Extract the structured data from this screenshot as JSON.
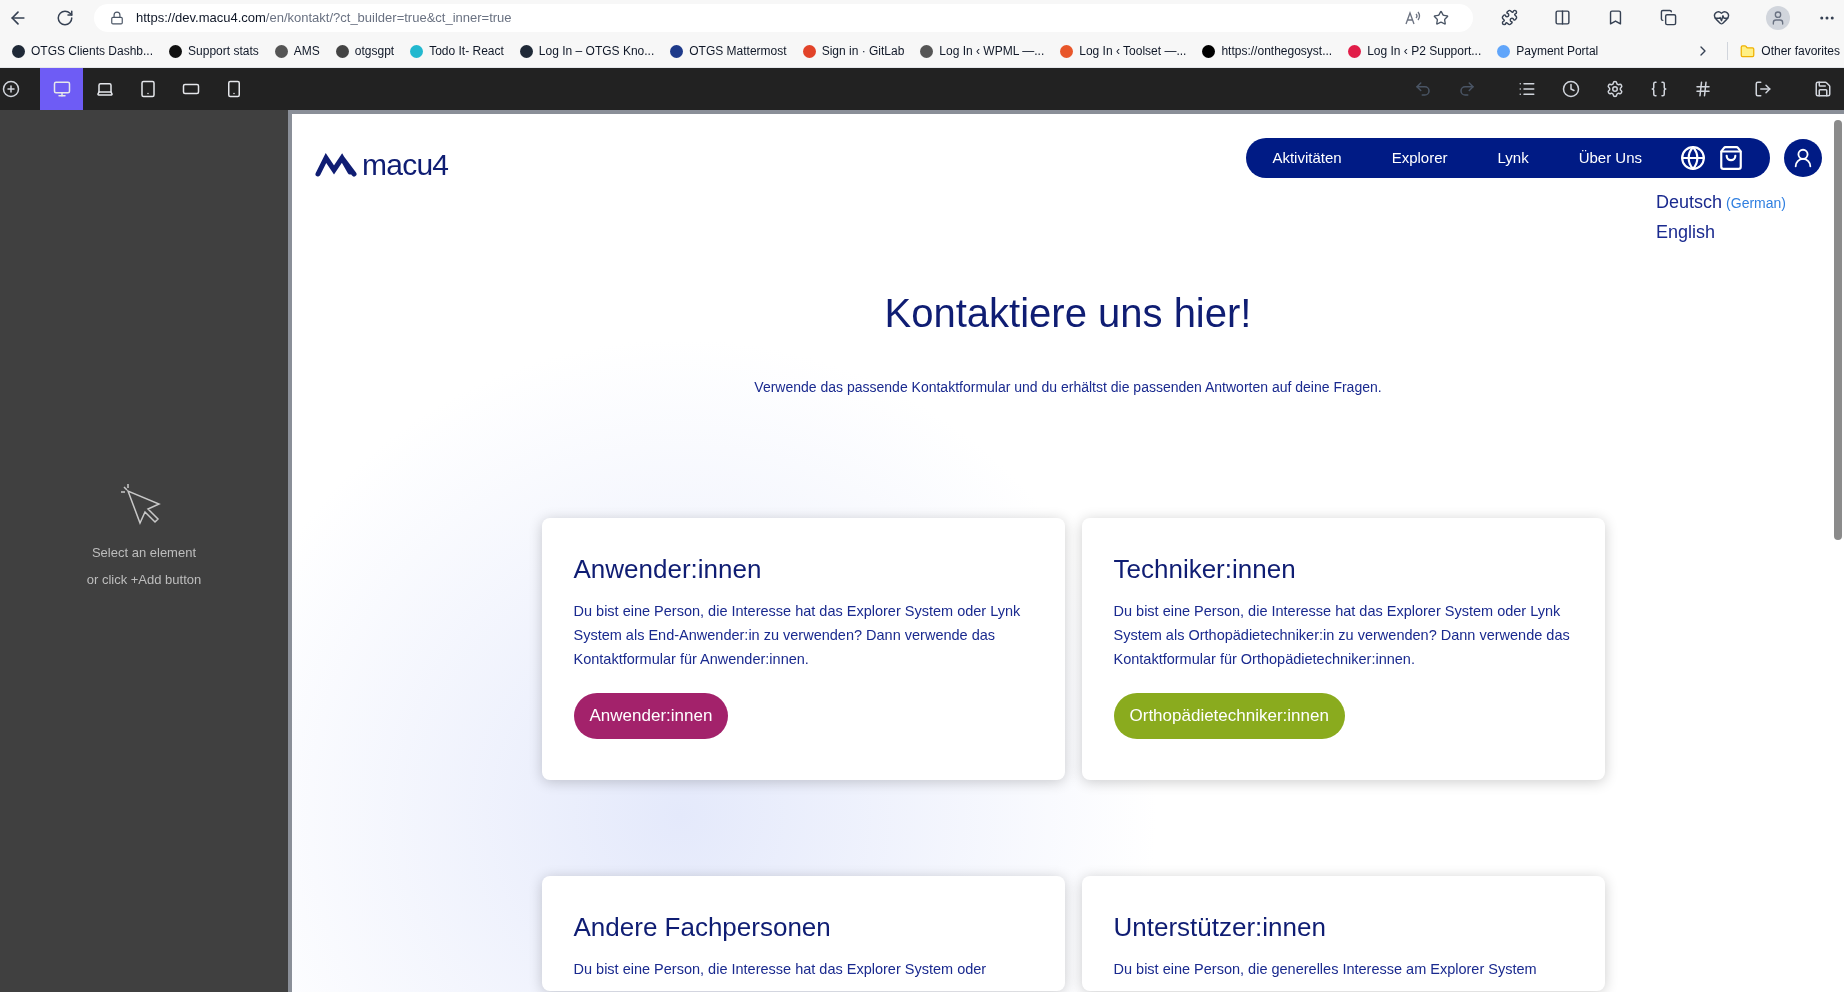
{
  "browser": {
    "url_host": "https://dev.macu4.com",
    "url_path": "/en/kontakt/?ct_builder=true&ct_inner=true",
    "bookmarks": [
      {
        "label": "OTGS Clients Dashb...",
        "color": "#1f2937"
      },
      {
        "label": "Support stats",
        "color": "#111111"
      },
      {
        "label": "AMS",
        "color": "#555555"
      },
      {
        "label": "otgsgpt",
        "color": "#444444"
      },
      {
        "label": "Todo It- React",
        "color": "#22b8cf"
      },
      {
        "label": "Log In – OTGS Kno...",
        "color": "#1f2937"
      },
      {
        "label": "OTGS Mattermost",
        "color": "#1e3a8a"
      },
      {
        "label": "Sign in · GitLab",
        "color": "#e24329"
      },
      {
        "label": "Log In ‹ WPML —...",
        "color": "#555555"
      },
      {
        "label": "Log In ‹ Toolset —...",
        "color": "#e8562a"
      },
      {
        "label": "https://onthegosyst...",
        "color": "#000000"
      },
      {
        "label": "Log In ‹ P2 Support...",
        "color": "#e11d48"
      },
      {
        "label": "Payment Portal",
        "color": "#60a5fa"
      }
    ],
    "other_favorites": "Other favorites"
  },
  "builder_toolbar": {
    "devices": [
      {
        "kind": "desktop",
        "selected": true
      },
      {
        "kind": "laptop",
        "selected": false
      },
      {
        "kind": "tablet",
        "selected": false
      },
      {
        "kind": "landscape",
        "selected": false
      },
      {
        "kind": "phone",
        "selected": false
      }
    ]
  },
  "left_panel": {
    "hint_1": "Select an element",
    "hint_2": "or click +Add button"
  },
  "site": {
    "logo": "macu4",
    "nav": [
      "Aktivitäten",
      "Explorer",
      "Lynk",
      "Über Uns"
    ],
    "languages": [
      {
        "label": "Deutsch",
        "note": "(German)"
      },
      {
        "label": "English"
      }
    ],
    "heading": "Kontaktiere uns hier!",
    "subtitle": "Verwende das passende Kontaktformular und du erhältst die passenden Antworten auf deine Fragen.",
    "cards": [
      {
        "title": "Anwender:innen",
        "text": "Du bist eine Person, die Interesse hat das Explorer System oder Lynk System als End-Anwender:in zu verwenden? Dann verwende das Kontaktformular für Anwender:innen.",
        "button": "Anwender:innen",
        "color": "#a3226b"
      },
      {
        "title": "Techniker:innen",
        "text": "Du bist eine Person, die Interesse hat das Explorer System oder Lynk System als Orthopädietechniker:in zu verwenden? Dann verwende das Kontaktformular für Orthopädietechniker:innen.",
        "button": "Orthopädietechniker:innen",
        "color": "#8aab1e"
      },
      {
        "title": "Andere Fachpersonen",
        "text": "Du bist eine Person, die Interesse hat das Explorer System oder"
      },
      {
        "title": "Unterstützer:innen",
        "text": "Du bist eine Person, die generelles Interesse am Explorer System"
      }
    ]
  }
}
